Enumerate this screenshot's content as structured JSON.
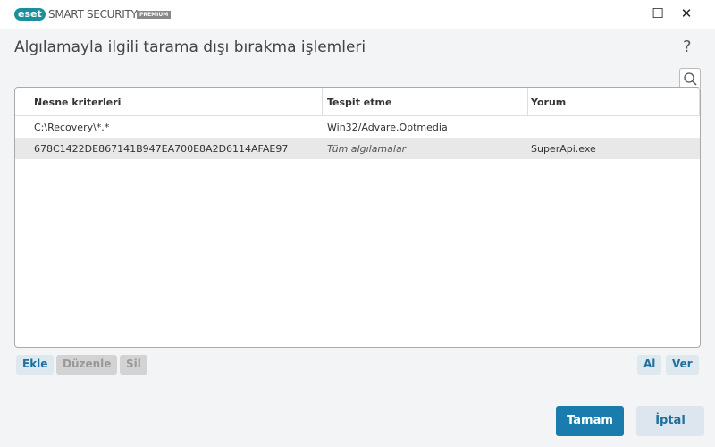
{
  "app": {
    "logo": "eset",
    "name": "SMART SECURITY",
    "edition": "PREMIUM"
  },
  "window": {
    "minimize": "☐",
    "close": "✕"
  },
  "title": "Algılamayla ilgili tarama dışı bırakma işlemleri",
  "help": "?",
  "table": {
    "headers": [
      "Nesne kriterleri",
      "Tespit etme",
      "Yorum"
    ],
    "rows": [
      [
        "C:\\Recovery\\*.*",
        "Win32/Advare.Optmedia",
        ""
      ],
      [
        "678C1422DE867141B947EA700E8A2D6114AFAE97",
        "Tüm algılamalar",
        "SuperApi.exe"
      ]
    ]
  },
  "buttons": {
    "add": "Ekle",
    "edit": "Düzenle",
    "delete": "Sil",
    "import": "Al",
    "export": "Ver",
    "ok": "Tamam",
    "cancel": "İptal"
  }
}
